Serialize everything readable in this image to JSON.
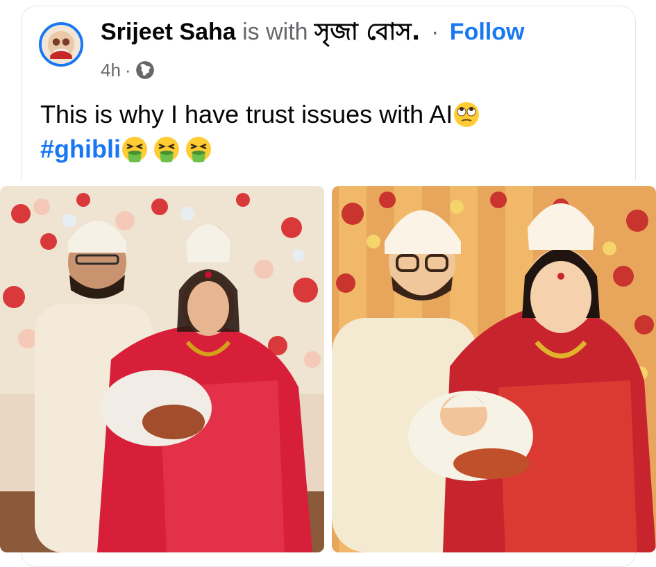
{
  "post": {
    "author": "Srijeet Saha",
    "with_text": "is with",
    "tagged": "সৃজা বোস.",
    "separator": "·",
    "follow_label": "Follow",
    "time": "4h",
    "meta_separator": "·",
    "privacy_icon": "globe-icon",
    "text": "This is why I have trust issues with AI",
    "hashtag": "#ghibli",
    "emojis": [
      "face-with-rolling-eyes",
      "face-vomiting",
      "face-vomiting",
      "face-vomiting"
    ]
  },
  "photos": [
    {
      "name": "real-wedding-photo"
    },
    {
      "name": "ghibli-style-illustration"
    }
  ],
  "colors": {
    "link": "#1877f2",
    "text": "#050505",
    "secondary": "#65676b"
  }
}
